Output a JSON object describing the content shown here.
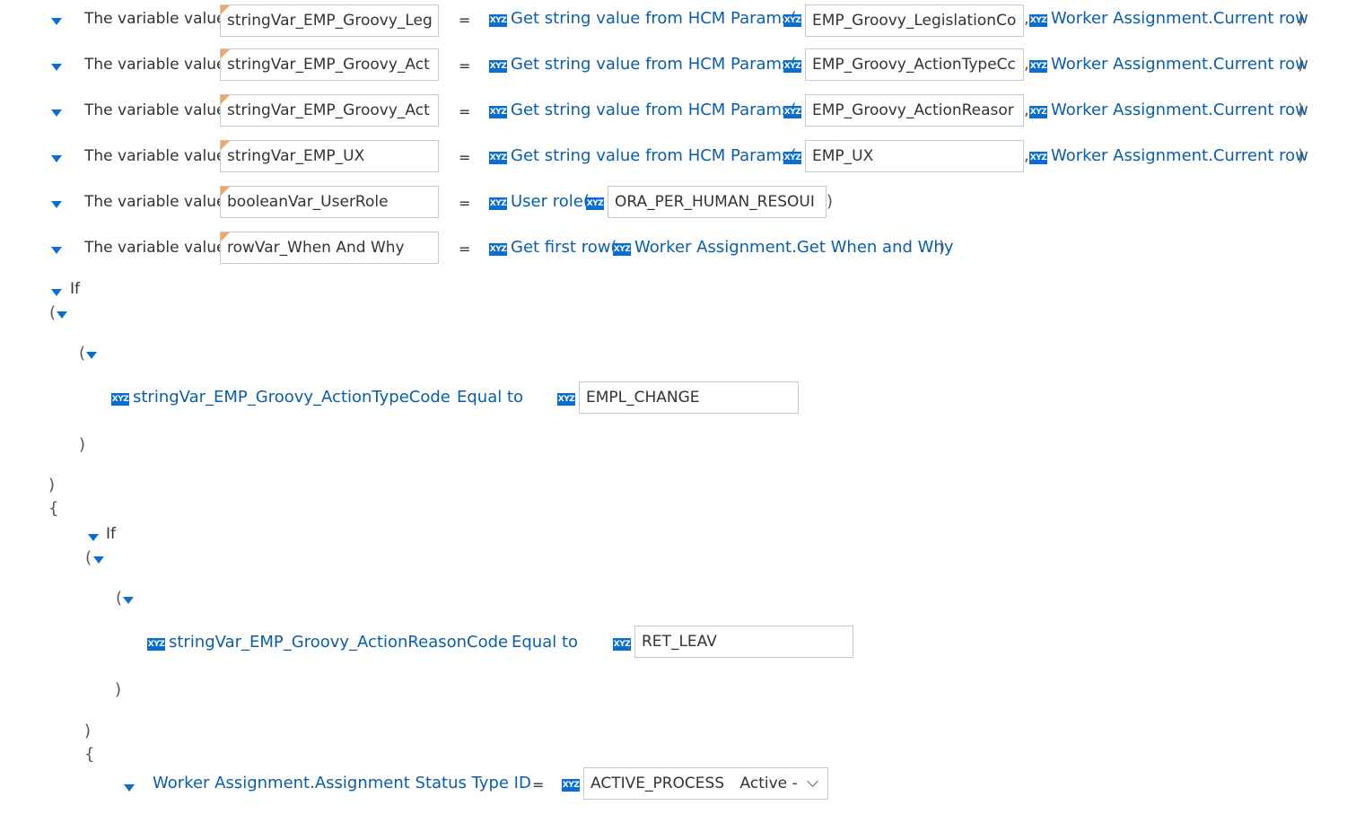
{
  "assignments": [
    {
      "label": "The variable value",
      "var": "stringVar_EMP_Groovy_Leg",
      "op": "=",
      "func": "Get string value from HCM Params(",
      "arg": "EMP_Groovy_LegislationCo",
      "sep": ",",
      "ctx": "Worker Assignment.Current row",
      "close": ")"
    },
    {
      "label": "The variable value",
      "var": "stringVar_EMP_Groovy_Act",
      "op": "=",
      "func": "Get string value from HCM Params(",
      "arg": "EMP_Groovy_ActionTypeCc",
      "sep": ",",
      "ctx": "Worker Assignment.Current row",
      "close": ")"
    },
    {
      "label": "The variable value",
      "var": "stringVar_EMP_Groovy_Act",
      "op": "=",
      "func": "Get string value from HCM Params(",
      "arg": "EMP_Groovy_ActionReasor",
      "sep": ",",
      "ctx": "Worker Assignment.Current row",
      "close": ")"
    },
    {
      "label": "The variable value",
      "var": "stringVar_EMP_UX",
      "op": "=",
      "func": "Get string value from HCM Params(",
      "arg": "EMP_UX",
      "sep": ",",
      "ctx": "Worker Assignment.Current row",
      "close": ")"
    }
  ],
  "user_role_row": {
    "label": "The variable value",
    "var": "booleanVar_UserRole",
    "op": "=",
    "func": "User role(",
    "arg": "ORA_PER_HUMAN_RESOUI",
    "close": ")"
  },
  "first_row": {
    "label": "The variable value",
    "var": "rowVar_When And Why",
    "op": "=",
    "func": "Get first row(",
    "arg": "Worker Assignment.Get When and Why",
    "close": ")"
  },
  "icon_text": "XYZ",
  "if1": {
    "keyword": "If",
    "open_paren": "(",
    "inner_open": "(",
    "inner_close": ")",
    "close_paren": ")",
    "brace": "{",
    "var": "stringVar_EMP_Groovy_ActionTypeCode",
    "op": "Equal to",
    "value": "EMPL_CHANGE"
  },
  "if2": {
    "keyword": "If",
    "open_paren": "(",
    "inner_open": "(",
    "inner_close": ")",
    "close_paren": ")",
    "brace": "{",
    "var": "stringVar_EMP_Groovy_ActionReasonCode",
    "op": "Equal to",
    "value": "RET_LEAV"
  },
  "status_row": {
    "field": "Worker Assignment.Assignment Status Type ID",
    "op": "=",
    "value": "ACTIVE_PROCESS",
    "value_desc": "Active -"
  },
  "colors": {
    "accent": "#0a6ed1",
    "link": "#0a5ea8",
    "flag": "#f0a868"
  }
}
